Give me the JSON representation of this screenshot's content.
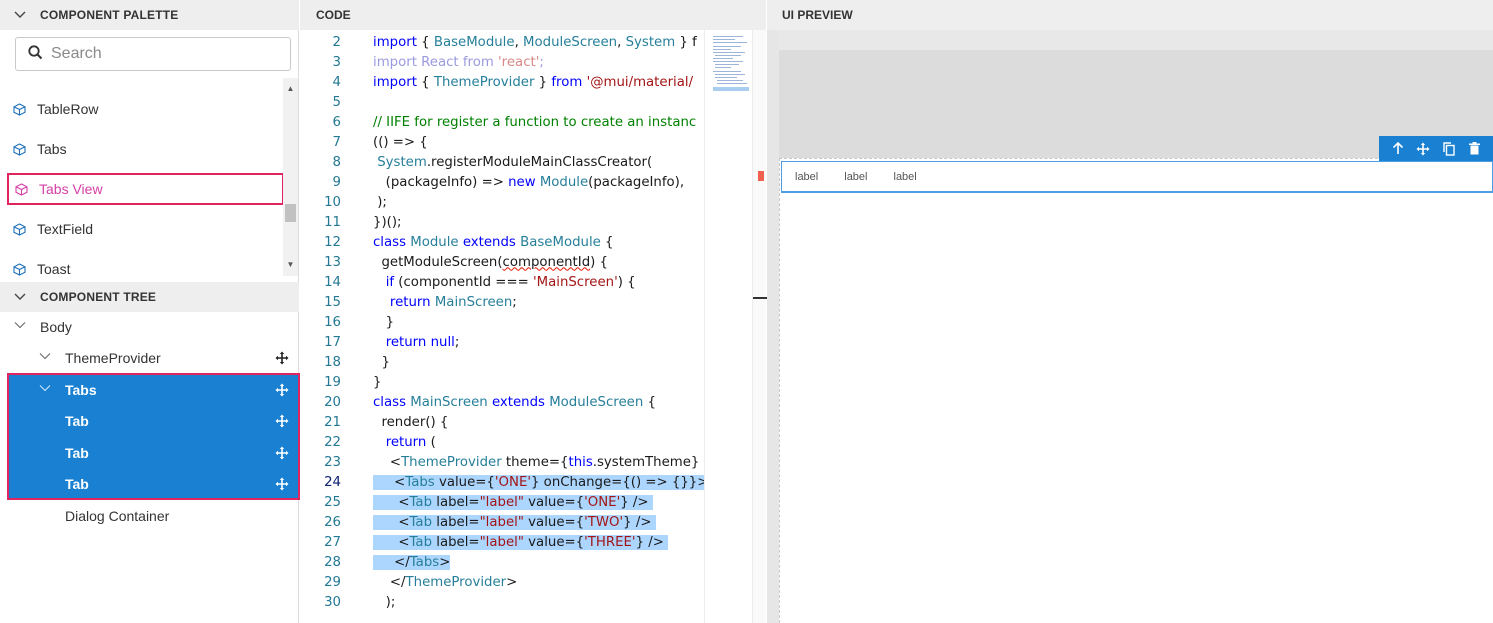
{
  "palette": {
    "header": "COMPONENT PALETTE",
    "search_placeholder": "Search",
    "items": [
      "TableRow",
      "Tabs",
      "Tabs View",
      "TextField",
      "Toast"
    ]
  },
  "tree": {
    "header": "COMPONENT TREE",
    "nodes": [
      "Body",
      "ThemeProvider",
      "Tabs",
      "Tab",
      "Tab",
      "Tab",
      "Dialog Container"
    ]
  },
  "code": {
    "header": "CODE",
    "line_numbers": [
      "2",
      "3",
      "4",
      "5",
      "6",
      "7",
      "8",
      "9",
      "10",
      "11",
      "12",
      "13",
      "14",
      "15",
      "16",
      "17",
      "18",
      "19",
      "20",
      "21",
      "22",
      "23",
      "24",
      "25",
      "26",
      "27",
      "28",
      "29",
      "30"
    ],
    "active_line": "24"
  },
  "preview": {
    "header": "UI PREVIEW",
    "tab_labels": [
      "label",
      "label",
      "label"
    ]
  },
  "colors": {
    "selection_blue": "#1a81d2",
    "highlight_pink": "#e0245e",
    "code_selection": "#add6ff"
  },
  "icons": [
    "chevron-down-icon",
    "search-icon",
    "cube-icon",
    "move-icon",
    "arrow-up-icon",
    "copy-icon",
    "trash-icon"
  ]
}
